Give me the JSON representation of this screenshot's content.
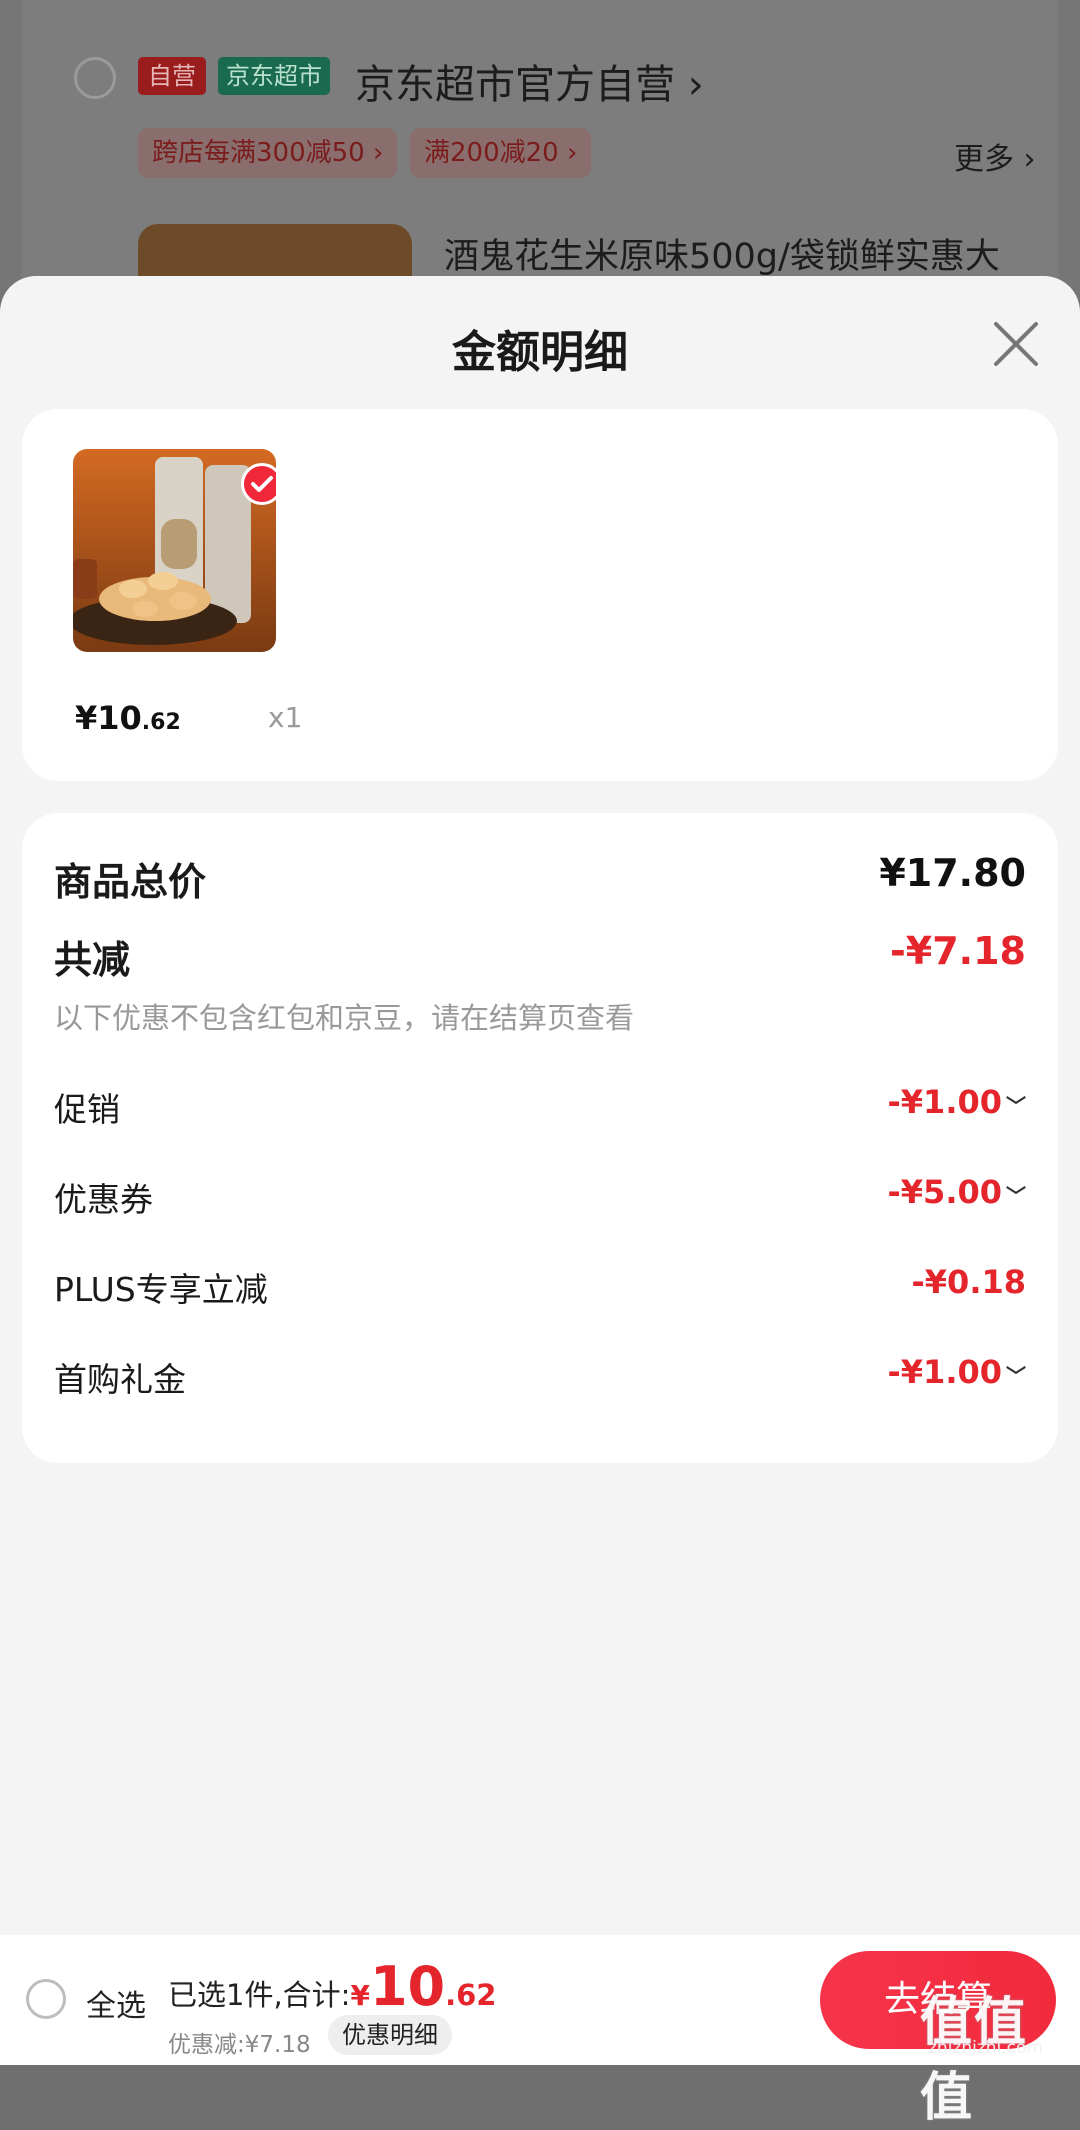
{
  "background": {
    "store": {
      "tag_self": "自营",
      "tag_jd": "京东超市",
      "name": "京东超市官方自营",
      "chevron": "›"
    },
    "promos": [
      "跨店每满300减50 ›",
      "满200减20 ›"
    ],
    "more": "更多 ›",
    "product_title": "酒鬼花生米原味500g/袋锁鲜实惠大"
  },
  "sheet": {
    "title": "金额明细",
    "close_icon": "close-icon"
  },
  "product": {
    "price_int": "¥10",
    "price_dec": ".62",
    "qty": "x1"
  },
  "details": {
    "total_label": "商品总价",
    "total_value": "¥17.80",
    "reduce_label": "共减",
    "reduce_value": "-¥7.18",
    "hint": "以下优惠不包含红包和京豆，请在结算页查看",
    "items": [
      {
        "label": "促销",
        "value": "-¥1.00",
        "expandable": true
      },
      {
        "label": "优惠券",
        "value": "-¥5.00",
        "expandable": true
      },
      {
        "label": "PLUS专享立减",
        "value": "-¥0.18",
        "expandable": false
      },
      {
        "label": "首购礼金",
        "value": "-¥1.00",
        "expandable": true
      }
    ]
  },
  "bottom": {
    "select_all": "全选",
    "selected_text": "已选1件,合计:",
    "currency": "¥",
    "total_int": "10",
    "total_dec": ".62",
    "discount": "优惠减:¥7.18",
    "detail_button": "优惠明细",
    "checkout": "去结算"
  },
  "watermark": {
    "text": "值值值",
    "url": "zhizhizhi.com"
  },
  "colors": {
    "accent_red": "#e4262c",
    "checkout_red": "#f5344a"
  }
}
